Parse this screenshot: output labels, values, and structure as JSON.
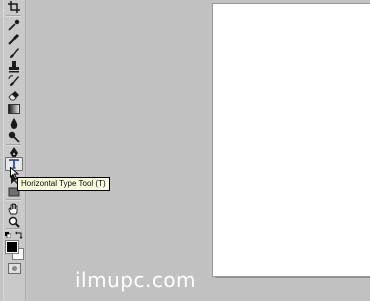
{
  "tooltip": {
    "text": "Horizontal Type Tool (T)"
  },
  "watermark": {
    "text": "ilmupc.com"
  },
  "colors": {
    "foreground": "#000000",
    "background": "#ffffff",
    "workspace": "#c1c1c1",
    "tooltip_bg": "#ffffe1"
  },
  "tools": [
    "crop-tool-icon",
    "eyedropper-tool-icon",
    "healing-brush-tool-icon",
    "brush-tool-icon",
    "clone-stamp-tool-icon",
    "history-brush-tool-icon",
    "eraser-tool-icon",
    "gradient-tool-icon",
    "blur-tool-icon",
    "dodge-tool-icon",
    "pen-tool-icon",
    "horizontal-type-tool-icon",
    "path-selection-tool-icon",
    "rectangle-tool-icon",
    "hand-tool-icon",
    "zoom-tool-icon"
  ],
  "active_tool": "horizontal-type-tool-icon"
}
